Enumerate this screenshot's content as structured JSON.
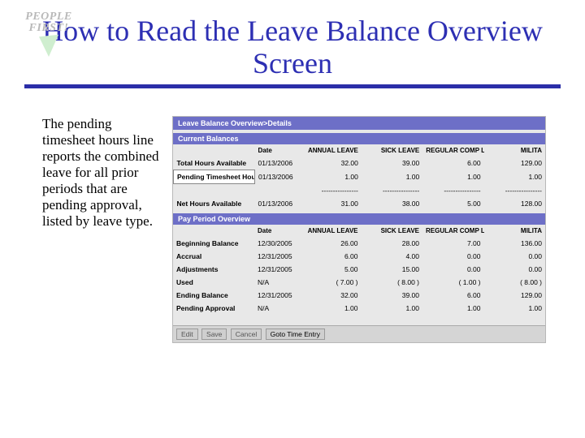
{
  "logo": {
    "line1": "PEOPLE",
    "line2": "FIRST!"
  },
  "title": "How to Read the Leave Balance Overview Screen",
  "description": "The pending timesheet hours line reports the combined leave for all prior periods that are pending approval, listed by leave type.",
  "screenshot": {
    "header": "Leave Balance Overview>Details",
    "section1": "Current Balances",
    "section2": "Pay Period Overview",
    "cols": [
      "",
      "Date",
      "ANNUAL LEAVE",
      "SICK LEAVE",
      "REGULAR COMP LEAVE",
      "MILITA"
    ],
    "current": [
      {
        "label": "Total Hours Available",
        "date": "01/13/2006",
        "v": [
          "32.00",
          "39.00",
          "6.00",
          "129.00"
        ]
      },
      {
        "label": "Pending Timesheet Hours",
        "date": "01/13/2006",
        "v": [
          "1.00",
          "1.00",
          "1.00",
          "1.00"
        ],
        "highlight": true
      },
      {
        "label": "",
        "date": "",
        "v": [
          "----------------",
          "----------------",
          "----------------",
          "----------------"
        ]
      },
      {
        "label": "Net Hours Available",
        "date": "01/13/2006",
        "v": [
          "31.00",
          "38.00",
          "5.00",
          "128.00"
        ]
      }
    ],
    "period": [
      {
        "label": "Beginning Balance",
        "date": "12/30/2005",
        "v": [
          "26.00",
          "28.00",
          "7.00",
          "136.00"
        ]
      },
      {
        "label": "Accrual",
        "date": "12/31/2005",
        "v": [
          "6.00",
          "4.00",
          "0.00",
          "0.00"
        ]
      },
      {
        "label": "Adjustments",
        "date": "12/31/2005",
        "v": [
          "5.00",
          "15.00",
          "0.00",
          "0.00"
        ]
      },
      {
        "label": "Used",
        "date": "N/A",
        "v": [
          "( 7.00 )",
          "( 8.00 )",
          "( 1.00 )",
          "( 8.00 )"
        ]
      },
      {
        "label": "Ending Balance",
        "date": "12/31/2005",
        "v": [
          "32.00",
          "39.00",
          "6.00",
          "129.00"
        ]
      },
      {
        "label": "Pending Approval",
        "date": "N/A",
        "v": [
          "1.00",
          "1.00",
          "1.00",
          "1.00"
        ]
      }
    ],
    "buttons": {
      "edit": "Edit",
      "save": "Save",
      "cancel": "Cancel",
      "goto": "Goto Time Entry"
    }
  }
}
